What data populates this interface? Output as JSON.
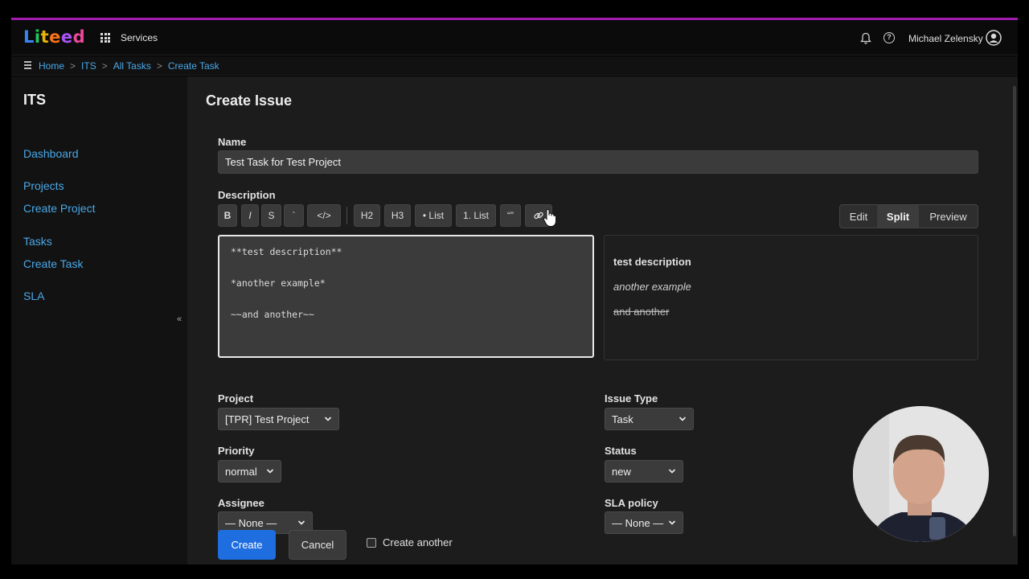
{
  "app": {
    "logo_letters": [
      "L",
      "i",
      "t",
      "e",
      "e",
      "d"
    ],
    "logo_colors": [
      "#3b82f6",
      "#22c55e",
      "#eab308",
      "#f97316",
      "#a855f7",
      "#ec4899"
    ],
    "services_label": "Services",
    "user_name": "Michael Zelensky"
  },
  "breadcrumb": [
    "Home",
    "ITS",
    "All Tasks",
    "Create Task"
  ],
  "sidebar": {
    "title": "ITS",
    "items": [
      "Dashboard",
      "Projects",
      "Create Project",
      "Tasks",
      "Create Task",
      "SLA"
    ],
    "collapse_label": "«"
  },
  "form": {
    "page_title": "Create Issue",
    "name_label": "Name",
    "name_value": "Test Task for Test Project",
    "description_label": "Description",
    "toolbar": [
      "B",
      "I",
      "S",
      "`",
      "</>",
      "H2",
      "H3",
      "• List",
      "1. List",
      "“”"
    ],
    "toolbar_link_icon": "link-icon",
    "modes": [
      "Edit",
      "Split",
      "Preview"
    ],
    "active_mode": "Split",
    "editor_lines": [
      "**test description**",
      "",
      "*another example*",
      "",
      "~~and another~~"
    ],
    "preview": {
      "bold": "test description",
      "italic": "another example",
      "strike": "and another"
    },
    "project_label": "Project",
    "project_value": "[TPR] Test Project",
    "issue_type_label": "Issue Type",
    "issue_type_value": "Task",
    "priority_label": "Priority",
    "priority_value": "normal",
    "status_label": "Status",
    "status_value": "new",
    "assignee_label": "Assignee",
    "assignee_value": "— None —",
    "sla_label": "SLA policy",
    "sla_value": "— None —",
    "create_label": "Create",
    "cancel_label": "Cancel",
    "create_another_label": "Create another",
    "create_another_checked": false
  },
  "colors": {
    "accent_line": "#a21caf",
    "link": "#4aa8e8",
    "primary_button": "#1f6ee0"
  }
}
